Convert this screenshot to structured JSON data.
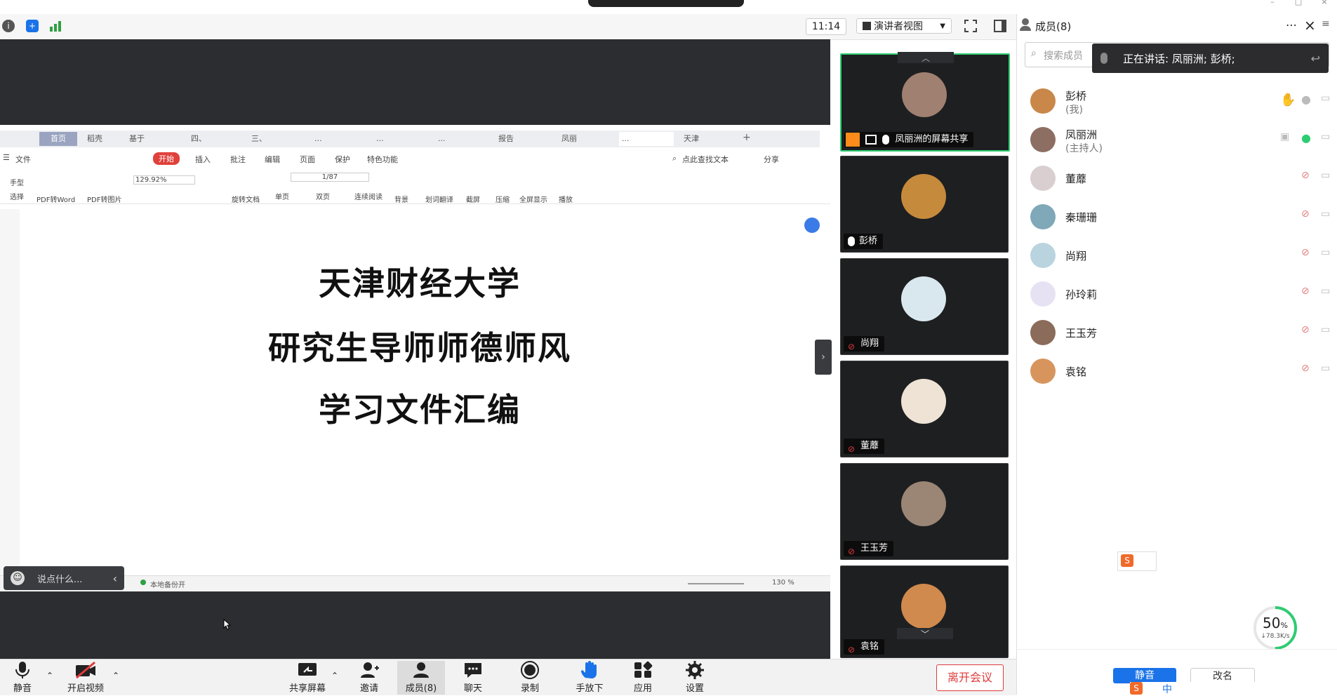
{
  "window": {
    "title_bar_label": "",
    "clock": "11:14",
    "view_mode": "演讲者视图"
  },
  "members_panel": {
    "title": "成员(8)",
    "search_placeholder": "搜索成员",
    "speaking_banner": "正在讲话: 凤丽洲; 彭桥;",
    "members": [
      {
        "name": "彭桥",
        "sub": "(我)",
        "avatar_color": "#c9874a"
      },
      {
        "name": "凤丽洲",
        "sub": "(主持人)",
        "avatar_color": "#8d6e63"
      },
      {
        "name": "董蘼",
        "sub": "",
        "avatar_color": "#d9cfd0"
      },
      {
        "name": "秦珊珊",
        "sub": "",
        "avatar_color": "#7fa8b8"
      },
      {
        "name": "尚翔",
        "sub": "",
        "avatar_color": "#b9d4de"
      },
      {
        "name": "孙玲莉",
        "sub": "",
        "avatar_color": "#e7e2f3"
      },
      {
        "name": "王玉芳",
        "sub": "",
        "avatar_color": "#8b6b5a"
      },
      {
        "name": "袁铭",
        "sub": "",
        "avatar_color": "#d7955d"
      }
    ],
    "mute_all_label": "静音",
    "rename_label": "改名",
    "network": {
      "percent": "50",
      "percent_sign": "%",
      "speed": "↓78.3K/s"
    }
  },
  "video_tiles": [
    {
      "label": "凤丽洲的屏幕共享",
      "avatar_color": "#a08070"
    },
    {
      "label": "彭桥",
      "avatar_color": "#c68a3c"
    },
    {
      "label": "尚翔",
      "avatar_color": "#d9e8ee"
    },
    {
      "label": "董蘼",
      "avatar_color": "#efe3d6"
    },
    {
      "label": "王玉芳",
      "avatar_color": "#9b8676"
    },
    {
      "label": "袁铭",
      "avatar_color": "#d08a4d"
    }
  ],
  "shared_doc": {
    "tabs": [
      "首页",
      "稻壳",
      "基于",
      "四、",
      "三、",
      "...",
      "...",
      "...",
      "报告",
      "凤丽",
      "...",
      "天津"
    ],
    "menu": [
      "文件",
      "开始",
      "插入",
      "批注",
      "编辑",
      "页面",
      "保护",
      "特色功能"
    ],
    "search_text": "点此查找文本",
    "share_label": "分享",
    "toolbar": {
      "hand": "手型",
      "select": "选择",
      "pdf_to_word": "PDF转Word",
      "pdf_to_image": "PDF转图片",
      "zoom": "129.92%",
      "rotate": "旋转文档",
      "page_indicator": "1/87",
      "single": "单页",
      "double": "双页",
      "continuous": "连续阅读",
      "background": "背景",
      "translate": "划词翻译",
      "screenshot": "截屏",
      "compress": "压缩",
      "fullscreen": "全屏显示",
      "play": "播放"
    },
    "lines": [
      "天津财经大学",
      "研究生导师师德师风",
      "学习文件汇编"
    ],
    "status_backup": "本地备份开",
    "status_zoom": "130 %",
    "chat_placeholder": "说点什么..."
  },
  "bottom_bar": {
    "mute": "静音",
    "video": "开启视频",
    "share": "共享屏幕",
    "invite": "邀请",
    "members": "成员(8)",
    "chat": "聊天",
    "record": "录制",
    "hand": "手放下",
    "apps": "应用",
    "settings": "设置",
    "leave": "离开会议"
  },
  "colors": {
    "accent": "#1a73e8",
    "danger": "#e03b3b",
    "stage": "#2b2d30",
    "active_tile": "#2ecc71"
  }
}
